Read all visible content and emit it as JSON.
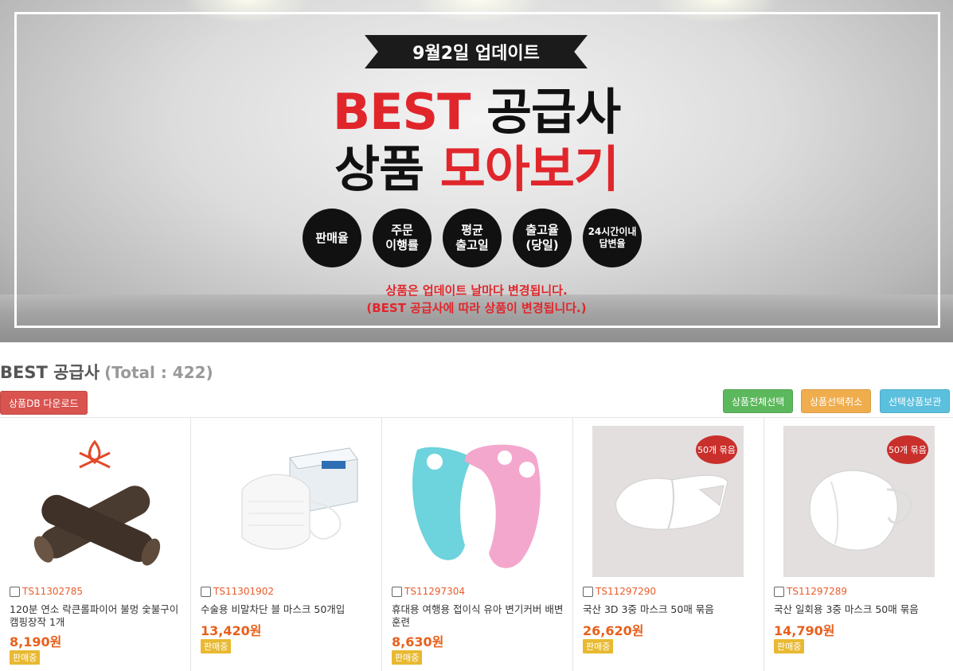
{
  "banner": {
    "ribbon": "9월2일 업데이트",
    "headline1_red": "BEST",
    "headline1_black": "공급사",
    "headline2_black": "상품",
    "headline2_red": "모아보기",
    "badges": [
      "판매율",
      "주문\n이행률",
      "평균\n출고일",
      "출고율\n(당일)",
      "24시간이내\n답변율"
    ],
    "notice1": "상품은 업데이트 날마다 변경됩니다.",
    "notice2": "(BEST 공급사에 따라 상품이 변경됩니다.)"
  },
  "section": {
    "title": "BEST 공급사",
    "total": "(Total : 422)"
  },
  "toolbar": {
    "download": "상품DB 다운로드",
    "select_all": "상품전체선택",
    "deselect": "상품선택취소",
    "save_selected": "선택상품보관"
  },
  "products": [
    {
      "code": "TS11302785",
      "name": "120분 연소 락큰롤파이어 불멍 숯불구이 캠핑장작 1개",
      "price": "8,190원",
      "status": "판매중",
      "pack_tag": ""
    },
    {
      "code": "TS11301902",
      "name": "수술용 비말차단 블 마스크 50개입",
      "price": "13,420원",
      "status": "판매중",
      "pack_tag": ""
    },
    {
      "code": "TS11297304",
      "name": "휴대용 여행용 접이식 유아 변기커버 배변훈련",
      "price": "8,630원",
      "status": "판매중",
      "pack_tag": ""
    },
    {
      "code": "TS11297290",
      "name": "국산 3D 3중 마스크 50매 묶음",
      "price": "26,620원",
      "status": "판매중",
      "pack_tag": "50개 묶음"
    },
    {
      "code": "TS11297289",
      "name": "국산 일회용 3중 마스크 50매 묶음",
      "price": "14,790원",
      "status": "판매중",
      "pack_tag": "50개 묶음"
    }
  ],
  "colors": {
    "accent_red": "#e0262b",
    "price_orange": "#e8601c",
    "status_yellow": "#e8b931"
  }
}
